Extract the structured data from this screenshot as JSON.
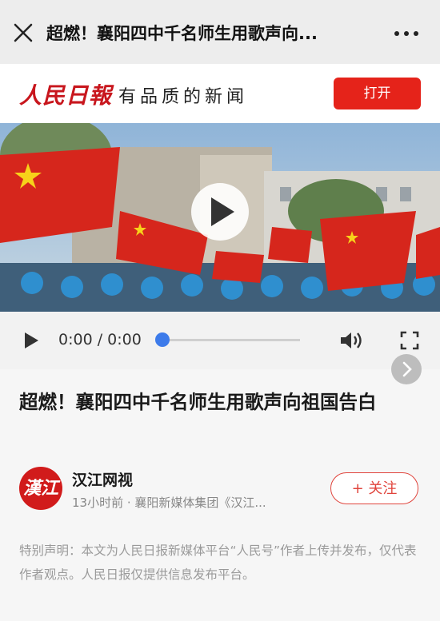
{
  "header": {
    "title": "超燃！襄阳四中千名师生用歌声向...",
    "close_icon": "close-icon",
    "more_icon": "more-icon"
  },
  "brand": {
    "logo_text": "人民日報",
    "slogan": "有品质的新闻",
    "open_label": "打开",
    "accent_color": "#e5231a"
  },
  "player": {
    "time": "0:00 / 0:00",
    "progress": 0,
    "play_icon": "play-icon",
    "volume_icon": "volume-icon",
    "fullscreen_icon": "fullscreen-icon"
  },
  "article": {
    "title": "超燃！襄阳四中千名师生用歌声向祖国告白",
    "author": "汉江网视",
    "avatar_text": "漢江",
    "meta": "13小时前 · 襄阳新媒体集团《汉江...",
    "follow_label": "+ 关注",
    "disclaimer": "特别声明：本文为人民日报新媒体平台“人民号”作者上传并发布，仅代表作者观点。人民日报仅提供信息发布平台。"
  }
}
